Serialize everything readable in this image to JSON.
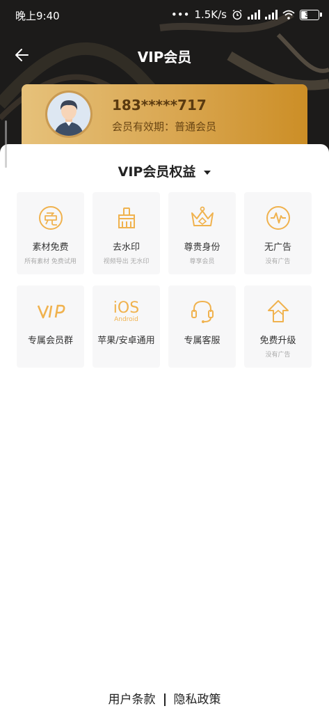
{
  "status_bar": {
    "time": "晚上9:40",
    "network_speed": "1.5K/s",
    "battery": "35"
  },
  "header": {
    "title": "VIP会员"
  },
  "member": {
    "phone": "183*****717",
    "validity": "会员有效期：普通会员"
  },
  "benefits": {
    "title": "VIP会员权益",
    "items": [
      {
        "label": "素材免费",
        "sub": "所有素材 免费试用",
        "icon": "free-icon"
      },
      {
        "label": "去水印",
        "sub": "视频导出 无水印",
        "icon": "brush-icon"
      },
      {
        "label": "尊贵身份",
        "sub": "尊享会员",
        "icon": "crown-icon"
      },
      {
        "label": "无广告",
        "sub": "没有广告",
        "icon": "no-ads-icon"
      },
      {
        "label": "专属会员群",
        "sub": "",
        "icon": "vip-text-icon"
      },
      {
        "label": "苹果/安卓通用",
        "sub": "",
        "icon": "ios-android-icon",
        "icon_text_main": "iOS",
        "icon_text_sub": "Android"
      },
      {
        "label": "专属客服",
        "sub": "",
        "icon": "headset-icon"
      },
      {
        "label": "免费升级",
        "sub": "没有广告",
        "icon": "upgrade-icon"
      }
    ]
  },
  "footer": {
    "terms": "用户条款",
    "privacy": "隐私政策"
  },
  "colors": {
    "accent": "#f0b24e",
    "card_gold": "#d9a650",
    "header_bg": "#1c1b1a"
  }
}
